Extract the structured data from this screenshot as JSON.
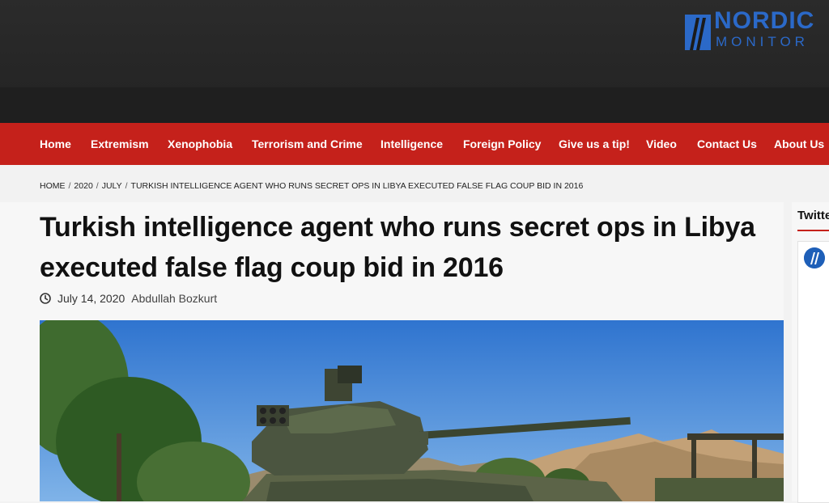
{
  "site": {
    "logo_line1": "NORDIC",
    "logo_line2": "MONITOR",
    "brand_color": "#2b69c8",
    "nav_color": "#c5211b"
  },
  "nav": [
    {
      "label": "Home"
    },
    {
      "label": "Extremism"
    },
    {
      "label": "Xenophobia"
    },
    {
      "label": "Terrorism and Crime"
    },
    {
      "label": "Intelligence"
    },
    {
      "label": "Foreign Policy"
    },
    {
      "label": "Give us a tip!"
    },
    {
      "label": "Video"
    },
    {
      "label": "Contact Us"
    },
    {
      "label": "About Us"
    }
  ],
  "breadcrumb": [
    {
      "label": "HOME"
    },
    {
      "label": "2020"
    },
    {
      "label": "JULY"
    },
    {
      "label": "TURKISH INTELLIGENCE AGENT WHO RUNS SECRET OPS IN LIBYA EXECUTED FALSE FLAG COUP BID IN 2016"
    }
  ],
  "article": {
    "title": "Turkish intelligence agent who runs secret ops in Libya executed false flag coup bid in 2016",
    "date": "July 14, 2020",
    "author": "Abdullah Bozkurt",
    "clock_icon": "clock-icon"
  },
  "sidebar": {
    "title": "Twitter"
  }
}
